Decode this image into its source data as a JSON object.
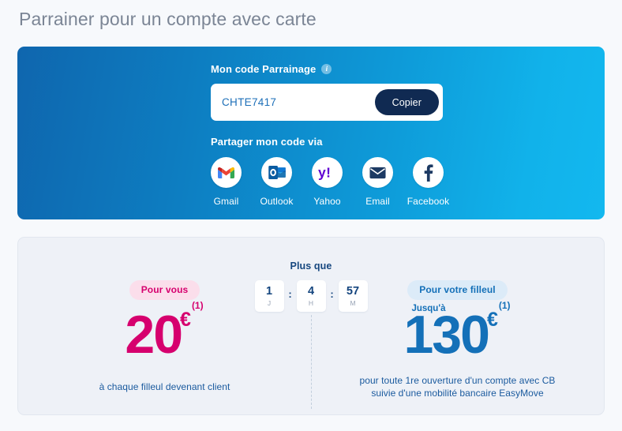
{
  "page": {
    "title": "Parrainer pour un compte avec carte",
    "background_color": "#f7f9fc",
    "title_color": "#7b8595"
  },
  "referral_card": {
    "gradient_from": "#0f66ae",
    "gradient_to": "#13b8ef",
    "code_label": "Mon code Parrainage",
    "info_icon_char": "i",
    "code_value": "CHTE7417",
    "copy_button_label": "Copier",
    "copy_button_color": "#102a52",
    "share_label": "Partager mon code via",
    "share_options": [
      {
        "name": "Gmail",
        "icon": "gmail-icon"
      },
      {
        "name": "Outlook",
        "icon": "outlook-icon"
      },
      {
        "name": "Yahoo",
        "icon": "yahoo-icon"
      },
      {
        "name": "Email",
        "icon": "email-icon"
      },
      {
        "name": "Facebook",
        "icon": "facebook-icon"
      }
    ]
  },
  "offer_card": {
    "background_color": "#eef1f7",
    "countdown": {
      "label": "Plus que",
      "separator": ":",
      "units": [
        {
          "value": "1",
          "unit": "J"
        },
        {
          "value": "4",
          "unit": "H"
        },
        {
          "value": "57",
          "unit": "M"
        }
      ]
    },
    "left": {
      "badge": "Pour vous",
      "badge_color": "#d6006e",
      "badge_background": "#fbdeeb",
      "amount": "20",
      "currency": "€",
      "footnote_marker": "(1)",
      "amount_color": "#d6006e",
      "description": "à chaque filleul devenant client"
    },
    "right": {
      "badge": "Pour votre filleul",
      "badge_color": "#1470b8",
      "badge_background": "#dcebf8",
      "prefix": "Jusqu'à",
      "amount": "130",
      "currency": "€",
      "footnote_marker": "(1)",
      "amount_color": "#1470b8",
      "description": "pour toute 1re ouverture d'un compte avec CB\nsuivie d'une mobilité bancaire EasyMove"
    }
  }
}
